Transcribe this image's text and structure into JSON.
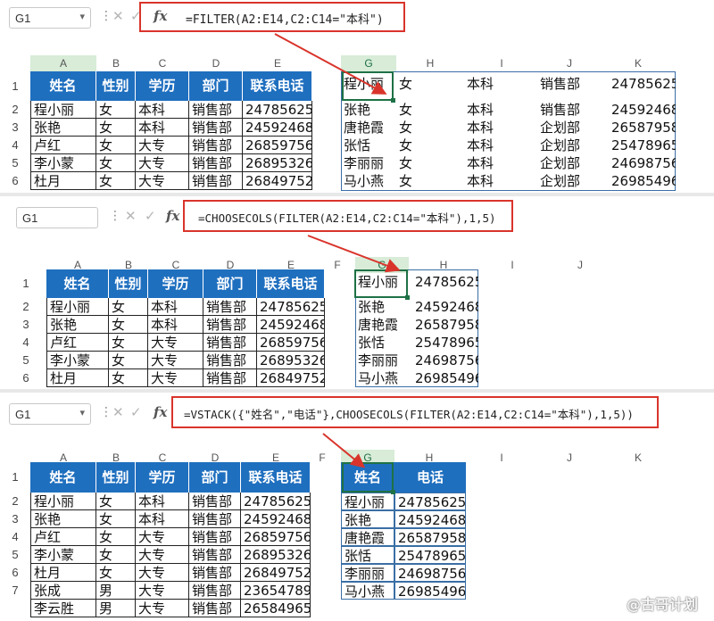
{
  "panel1": {
    "namebox": "G1",
    "formula": "=FILTER(A2:E14,C2:C14=\"本科\")",
    "cols_left": [
      "A",
      "B",
      "C",
      "D",
      "E"
    ],
    "cols_right": [
      "G",
      "H",
      "I",
      "J",
      "K"
    ],
    "rows": [
      "1",
      "2",
      "3",
      "4",
      "5",
      "6"
    ],
    "header": [
      "姓名",
      "性别",
      "学历",
      "部门",
      "联系电话"
    ],
    "data": [
      [
        "程小丽",
        "女",
        "本科",
        "销售部",
        "24785625"
      ],
      [
        "张艳",
        "女",
        "本科",
        "销售部",
        "24592468"
      ],
      [
        "卢红",
        "女",
        "大专",
        "销售部",
        "26859756"
      ],
      [
        "李小蒙",
        "女",
        "大专",
        "销售部",
        "26895326"
      ],
      [
        "杜月",
        "女",
        "大专",
        "销售部",
        "26849752"
      ]
    ],
    "result": [
      [
        "程小丽",
        "女",
        "本科",
        "销售部",
        "24785625"
      ],
      [
        "张艳",
        "女",
        "本科",
        "销售部",
        "24592468"
      ],
      [
        "唐艳霞",
        "女",
        "本科",
        "企划部",
        "26587958"
      ],
      [
        "张恬",
        "女",
        "本科",
        "企划部",
        "25478965"
      ],
      [
        "李丽丽",
        "女",
        "本科",
        "企划部",
        "24698756"
      ],
      [
        "马小燕",
        "女",
        "本科",
        "企划部",
        "26985496"
      ]
    ]
  },
  "panel2": {
    "namebox": "G1",
    "formula": "=CHOOSECOLS(FILTER(A2:E14,C2:C14=\"本科\"),1,5)",
    "cols_left": [
      "A",
      "B",
      "C",
      "D",
      "E",
      "F"
    ],
    "cols_right": [
      "G",
      "H",
      "I",
      "J"
    ],
    "rows": [
      "1",
      "2",
      "3",
      "4",
      "5",
      "6"
    ],
    "header": [
      "姓名",
      "性别",
      "学历",
      "部门",
      "联系电话"
    ],
    "data": [
      [
        "程小丽",
        "女",
        "本科",
        "销售部",
        "24785625"
      ],
      [
        "张艳",
        "女",
        "本科",
        "销售部",
        "24592468"
      ],
      [
        "卢红",
        "女",
        "大专",
        "销售部",
        "26859756"
      ],
      [
        "李小蒙",
        "女",
        "大专",
        "销售部",
        "26895326"
      ],
      [
        "杜月",
        "女",
        "大专",
        "销售部",
        "26849752"
      ]
    ],
    "result": [
      [
        "程小丽",
        "24785625"
      ],
      [
        "张艳",
        "24592468"
      ],
      [
        "唐艳霞",
        "26587958"
      ],
      [
        "张恬",
        "25478965"
      ],
      [
        "李丽丽",
        "24698756"
      ],
      [
        "马小燕",
        "26985496"
      ]
    ]
  },
  "panel3": {
    "namebox": "G1",
    "formula": "=VSTACK({\"姓名\",\"电话\"},CHOOSECOLS(FILTER(A2:E14,C2:C14=\"本科\"),1,5))",
    "cols_left": [
      "A",
      "B",
      "C",
      "D",
      "E",
      "F"
    ],
    "cols_right": [
      "G",
      "H",
      "I",
      "J",
      "K"
    ],
    "rows": [
      "1",
      "2",
      "3",
      "4",
      "5",
      "6",
      "7"
    ],
    "header": [
      "姓名",
      "性别",
      "学历",
      "部门",
      "联系电话"
    ],
    "data": [
      [
        "程小丽",
        "女",
        "本科",
        "销售部",
        "24785625"
      ],
      [
        "张艳",
        "女",
        "本科",
        "销售部",
        "24592468"
      ],
      [
        "卢红",
        "女",
        "大专",
        "销售部",
        "26859756"
      ],
      [
        "李小蒙",
        "女",
        "大专",
        "销售部",
        "26895326"
      ],
      [
        "杜月",
        "女",
        "大专",
        "销售部",
        "26849752"
      ],
      [
        "张成",
        "男",
        "大专",
        "销售部",
        "23654789"
      ],
      [
        "李云胜",
        "男",
        "大专",
        "销售部",
        "26584965"
      ]
    ],
    "result_header": [
      "姓名",
      "电话"
    ],
    "result": [
      [
        "程小丽",
        "24785625"
      ],
      [
        "张艳",
        "24592468"
      ],
      [
        "唐艳霞",
        "26587958"
      ],
      [
        "张恬",
        "25478965"
      ],
      [
        "李丽丽",
        "24698756"
      ],
      [
        "马小燕",
        "26985496"
      ]
    ]
  },
  "watermark": "@古哥计划",
  "icons": {
    "cancel": "✕",
    "confirm": "✓",
    "function": "fx",
    "more": "⋮",
    "dropdown": "▾"
  },
  "colors": {
    "header_fill": "#1f6fbf",
    "highlight": "#d9342b",
    "selection": "#1e7145"
  }
}
